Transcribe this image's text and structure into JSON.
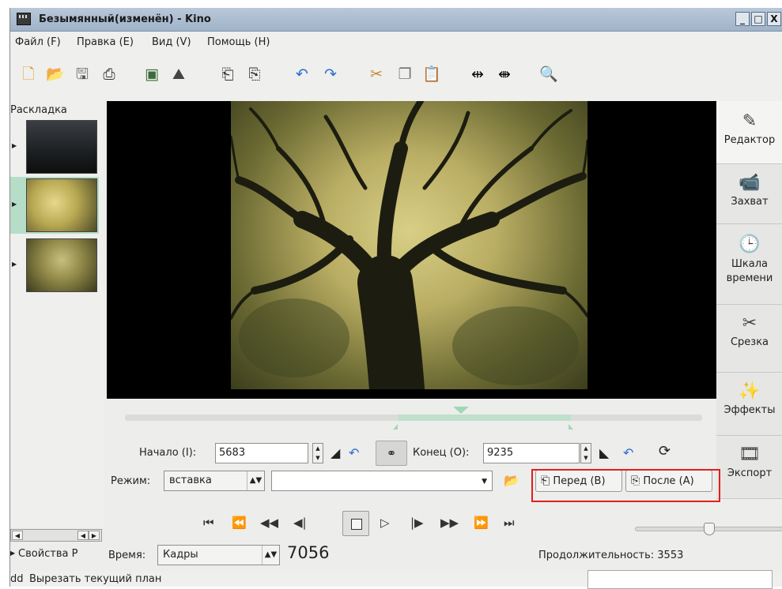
{
  "window": {
    "title": "Безымянный(изменён) - Kino",
    "min": "_",
    "max": "□",
    "close": "X"
  },
  "menu": [
    "Файл (F)",
    "Правка (E)",
    "Вид (V)",
    "Помощь (H)"
  ],
  "left_panel": {
    "title": "Раскладка",
    "properties": "Свойства P"
  },
  "right_tabs": [
    "Редактор",
    "Захват",
    "Шкала времени",
    "Срезка",
    "Эффекты",
    "Экспорт"
  ],
  "trim": {
    "start_label": "Начало (I):",
    "start_value": "5683",
    "end_label": "Конец (O):",
    "end_value": "9235",
    "mode_label": "Режим:",
    "mode_value": "вставка",
    "file_value": "",
    "before_button": "Перед (B)",
    "after_button": "После (A)"
  },
  "bottom": {
    "time_label": "Время:",
    "time_mode": "Кадры",
    "frame": "7056",
    "duration": "Продолжительность: 3553",
    "volume_fraction": 0.5
  },
  "status": {
    "key": "dd",
    "message": "Вырезать текущий план"
  },
  "colors": {
    "title_bar": "#b0c1d4",
    "selection": "#b6ddc8",
    "highlight_box": "#e0201f"
  }
}
